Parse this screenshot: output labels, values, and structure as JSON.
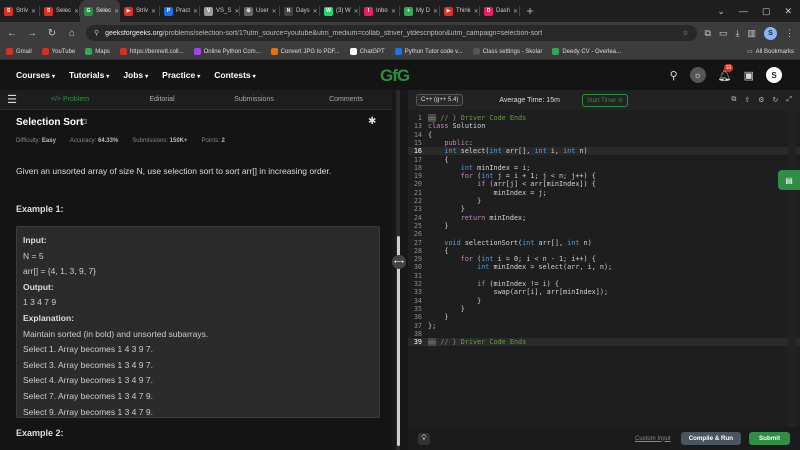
{
  "browser": {
    "tabs": [
      {
        "label": "Striv",
        "fav_color": "#d93025",
        "fav": "S"
      },
      {
        "label": "Selec",
        "fav_color": "#d93025",
        "fav": "S"
      },
      {
        "label": "Selec",
        "fav_color": "#2f8d46",
        "fav": "G",
        "active": true
      },
      {
        "label": "Striv",
        "fav_color": "#d93025",
        "fav": "▶"
      },
      {
        "label": "Pract",
        "fav_color": "#1a73e8",
        "fav": "P"
      },
      {
        "label": "VS_S",
        "fav_color": "#999999",
        "fav": "V"
      },
      {
        "label": "User",
        "fav_color": "#666666",
        "fav": "⚙"
      },
      {
        "label": "Days",
        "fav_color": "#444444",
        "fav": "N"
      },
      {
        "label": "(3) W",
        "fav_color": "#25d366",
        "fav": "W"
      },
      {
        "label": "Inbo",
        "fav_color": "#e91e63",
        "fav": "I"
      },
      {
        "label": "My D",
        "fav_color": "#34a853",
        "fav": "+"
      },
      {
        "label": "Think",
        "fav_color": "#d93025",
        "fav": "▶"
      },
      {
        "label": "Dash",
        "fav_color": "#e91e63",
        "fav": "D"
      }
    ],
    "new_tab": "+",
    "url_host": "geeksforgeeks.org",
    "url_path": "/problems/selection-sort/1?utm_source=youtube&utm_medium=collab_striver_ytdescription&utm_campaign=selection-sort",
    "profile_initial": "S",
    "bookmarks": [
      {
        "label": "Gmail",
        "color": "#d93025"
      },
      {
        "label": "YouTube",
        "color": "#d93025"
      },
      {
        "label": "Maps",
        "color": "#34a853"
      },
      {
        "label": "https://bennett.coll...",
        "color": "#d93025"
      },
      {
        "label": "Online Python Com...",
        "color": "#a142f4"
      },
      {
        "label": "Convert JPG to PDF...",
        "color": "#e8710a"
      },
      {
        "label": "ChatGPT",
        "color": "#ffffff"
      },
      {
        "label": "Python Tutor code v...",
        "color": "#1a73e8"
      },
      {
        "label": "Class settings - Skolar",
        "color": "#555555"
      },
      {
        "label": "Deedy CV - Overlea...",
        "color": "#34a853"
      }
    ],
    "all_bookmarks": "All Bookmarks"
  },
  "header": {
    "menu": [
      "Courses",
      "Tutorials",
      "Jobs",
      "Practice",
      "Contests"
    ],
    "logo": "GfG",
    "notification_count": "10",
    "user_initial": "S"
  },
  "problem": {
    "tabs": [
      "</> Problem",
      "Editorial",
      "Submissions",
      "Comments"
    ],
    "title": "Selection Sort",
    "meta": [
      {
        "label": "Difficulty:",
        "value": "Easy"
      },
      {
        "label": "Accuracy:",
        "value": "64.33%"
      },
      {
        "label": "Submissions:",
        "value": "150K+"
      },
      {
        "label": "Points:",
        "value": "2"
      }
    ],
    "statement": "Given an unsorted array of size N, use selection sort to sort arr[] in increasing order.",
    "example1_title": "Example 1:",
    "example1_lines": [
      {
        "text": "Input:",
        "bold": true
      },
      {
        "text": "N = 5"
      },
      {
        "text": "arr[] = {4, 1, 3, 9, 7}"
      },
      {
        "text": "Output:",
        "bold": true
      },
      {
        "text": "1 3 4 7 9"
      },
      {
        "text": "Explanation:",
        "bold": true
      },
      {
        "text": "Maintain sorted (in bold) and unsorted subarrays."
      },
      {
        "text": "Select 1. Array becomes 1 4 3 9 7."
      },
      {
        "text": "Select 3. Array becomes 1 3 4 9 7."
      },
      {
        "text": "Select 4. Array becomes 1 3 4 9 7."
      },
      {
        "text": "Select 7. Array becomes 1 3 4 7 9."
      },
      {
        "text": "Select 9. Array becomes 1 3 4 7 9."
      }
    ],
    "example2_title": "Example 2:"
  },
  "editor": {
    "language": "C++ (g++ 5.4)",
    "avg_time": "Average Time: 15m",
    "start_timer": "Start Timer ⊘",
    "lines": [
      {
        "n": "1",
        "html": "<span class='fold'>▭▭</span><span class='cm'> // } Driver Code Ends</span>"
      },
      {
        "n": "13",
        "html": "<span class='kw'>class</span><span class='tx'> Solution</span>"
      },
      {
        "n": "14",
        "html": "<span class='tx'>{</span>"
      },
      {
        "n": "15",
        "html": "<span class='kw'>    public</span><span class='tx'>:</span>"
      },
      {
        "n": "16",
        "html": "<span class='ty'>    int</span><span class='tx'> select(</span><span class='ty'>int</span><span class='tx'> arr[], </span><span class='ty'>int</span><span class='tx'> i, </span><span class='ty'>int</span><span class='tx'> n)</span>",
        "cur": true
      },
      {
        "n": "17",
        "html": "<span class='tx'>    {</span>"
      },
      {
        "n": "18",
        "html": "<span class='ty'>        int</span><span class='tx'> minIndex = i;</span>"
      },
      {
        "n": "19",
        "html": "<span class='kw'>        for</span><span class='tx'> (</span><span class='ty'>int</span><span class='tx'> j = i + 1; j &lt; n; j++) {</span>"
      },
      {
        "n": "20",
        "html": "<span class='kw'>            if</span><span class='tx'> (arr[j] &lt; arr[minIndex]) {</span>"
      },
      {
        "n": "21",
        "html": "<span class='tx'>                minIndex = j;</span>"
      },
      {
        "n": "22",
        "html": "<span class='tx'>            }</span>"
      },
      {
        "n": "23",
        "html": "<span class='tx'>        }</span>"
      },
      {
        "n": "24",
        "html": "<span class='kw'>        return</span><span class='tx'> minIndex;</span>"
      },
      {
        "n": "25",
        "html": "<span class='tx'>    }</span>"
      },
      {
        "n": "26",
        "html": ""
      },
      {
        "n": "27",
        "html": "<span class='ty'>    void</span><span class='tx'> selectionSort(</span><span class='ty'>int</span><span class='tx'> arr[], </span><span class='ty'>int</span><span class='tx'> n)</span>"
      },
      {
        "n": "28",
        "html": "<span class='tx'>    {</span>"
      },
      {
        "n": "29",
        "html": "<span class='kw'>        for</span><span class='tx'> (</span><span class='ty'>int</span><span class='tx'> i = 0; i &lt; n - 1; i++) {</span>"
      },
      {
        "n": "30",
        "html": "<span class='ty'>            int</span><span class='tx'> minIndex = select(arr, i, n);</span>"
      },
      {
        "n": "31",
        "html": ""
      },
      {
        "n": "32",
        "html": "<span class='kw'>            if</span><span class='tx'> (minIndex != i) {</span>"
      },
      {
        "n": "33",
        "html": "<span class='tx'>                swap(arr[i], arr[minIndex]);</span>"
      },
      {
        "n": "34",
        "html": "<span class='tx'>            }</span>"
      },
      {
        "n": "35",
        "html": "<span class='tx'>        }</span>"
      },
      {
        "n": "36",
        "html": "<span class='tx'>    }</span>"
      },
      {
        "n": "37",
        "html": "<span class='tx'>};</span>"
      },
      {
        "n": "38",
        "html": ""
      },
      {
        "n": "39",
        "html": "<span class='fold'>▭▭</span><span class='cm'> // } Driver Code Ends</span>",
        "cur": true
      }
    ],
    "custom_input": "Custom Input",
    "compile_run": "Compile & Run",
    "submit": "Submit"
  }
}
